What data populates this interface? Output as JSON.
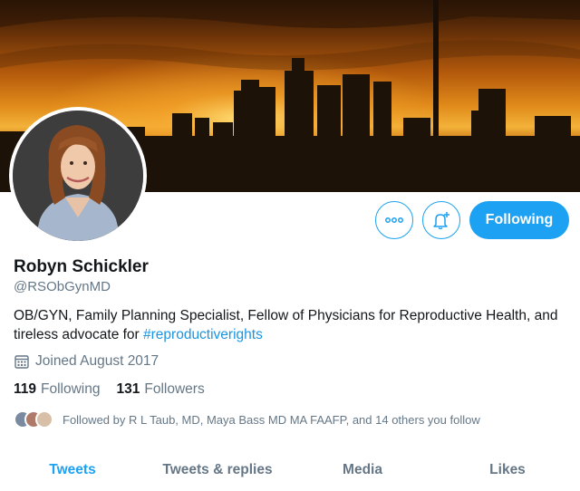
{
  "profile": {
    "name": "Robyn Schickler",
    "handle": "@RSObGynMD",
    "bio_text": "OB/GYN, Family Planning Specialist, Fellow of Physicians for Reproductive Health, and tireless advocate for ",
    "bio_hashtag": "#reproductiverights",
    "joined": "Joined August 2017",
    "following_count": "119",
    "following_label": "Following",
    "followers_count": "131",
    "followers_label": "Followers",
    "followed_by": "Followed by R L Taub, MD, Maya Bass MD MA FAAFP, and 14 others you follow"
  },
  "actions": {
    "more_icon": "more-horizontal-icon",
    "notify_icon": "bell-plus-icon",
    "follow_label": "Following"
  },
  "tabs": [
    {
      "label": "Tweets",
      "active": true
    },
    {
      "label": "Tweets & replies",
      "active": false
    },
    {
      "label": "Media",
      "active": false
    },
    {
      "label": "Likes",
      "active": false
    }
  ],
  "colors": {
    "accent": "#1da1f2",
    "secondary_text": "#657786",
    "primary_text": "#14171a"
  }
}
